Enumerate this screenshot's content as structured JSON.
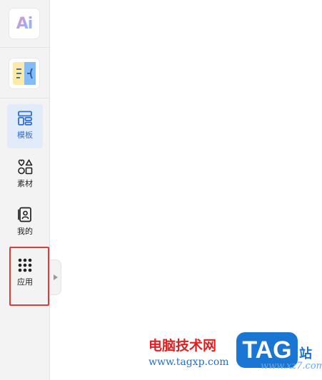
{
  "sidebar": {
    "tools": [
      {
        "name": "ai-tool",
        "icon": "ai-logo-icon",
        "text": "Ai"
      },
      {
        "name": "side-panel-tool",
        "icon": "panel-split-icon"
      }
    ],
    "items": [
      {
        "label": "模板",
        "icon": "template-layout-icon",
        "active": true
      },
      {
        "label": "素材",
        "icon": "shapes-icon",
        "active": false
      },
      {
        "label": "我的",
        "icon": "my-profile-icon",
        "active": false
      },
      {
        "label": "应用",
        "icon": "apps-grid-icon",
        "active": false
      }
    ]
  },
  "collapse_handle": {
    "icon": "caret-right-icon"
  },
  "watermark": {
    "site_name": "电脑技术网",
    "url": "www.tagxp.com",
    "badge": "TAG",
    "side_text": "站",
    "url2": "www.xz7.com"
  },
  "colors": {
    "accent": "#2f6fd6",
    "active_bg": "#e1ebfa",
    "highlight": "#e53935",
    "sidebar_bg": "#f3f3f3",
    "watermark_red": "#e02020",
    "watermark_blue": "#1976d2"
  }
}
